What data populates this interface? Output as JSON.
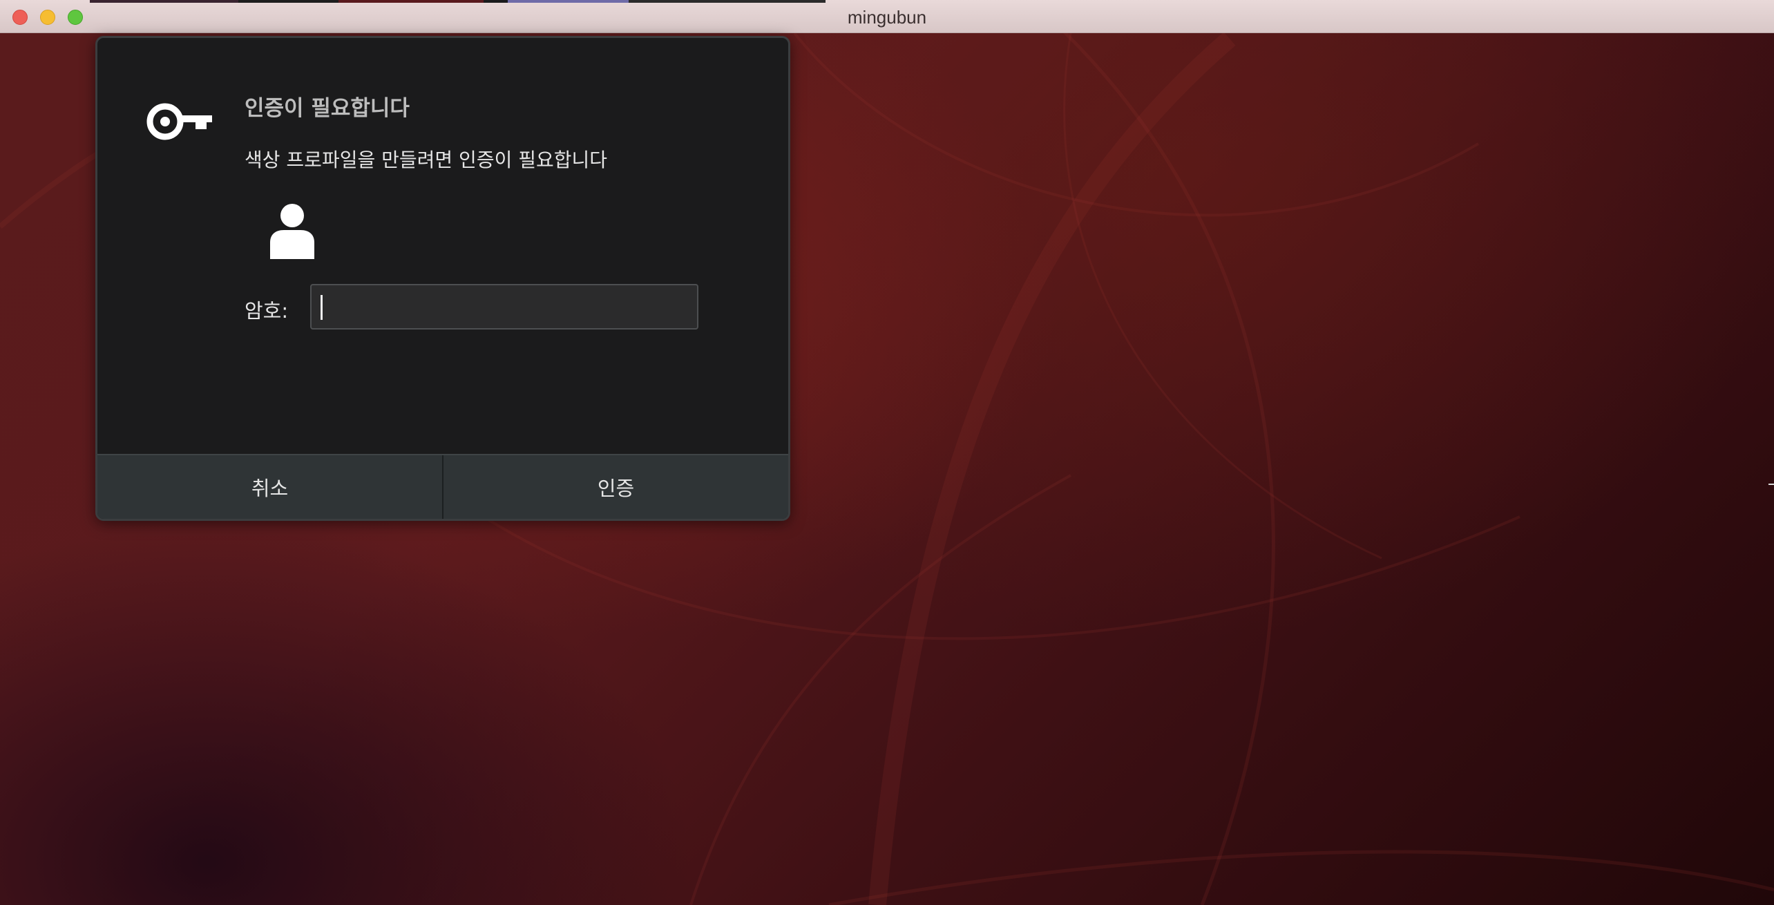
{
  "window": {
    "title": "mingubun"
  },
  "dialog": {
    "icon": "key-icon",
    "title": "인증이 필요합니다",
    "message": "색상 프로파일을 만들려면 인증이 필요합니다",
    "user_icon": "user-icon",
    "password_label": "암호:",
    "password_value": "",
    "buttons": {
      "cancel": "취소",
      "authenticate": "인증"
    }
  },
  "colors": {
    "dialog_bg": "#1b1b1c",
    "button_bar_bg": "#2f3436",
    "title_text": "#bdbdbd",
    "wallpaper": "#5a1b1c"
  }
}
